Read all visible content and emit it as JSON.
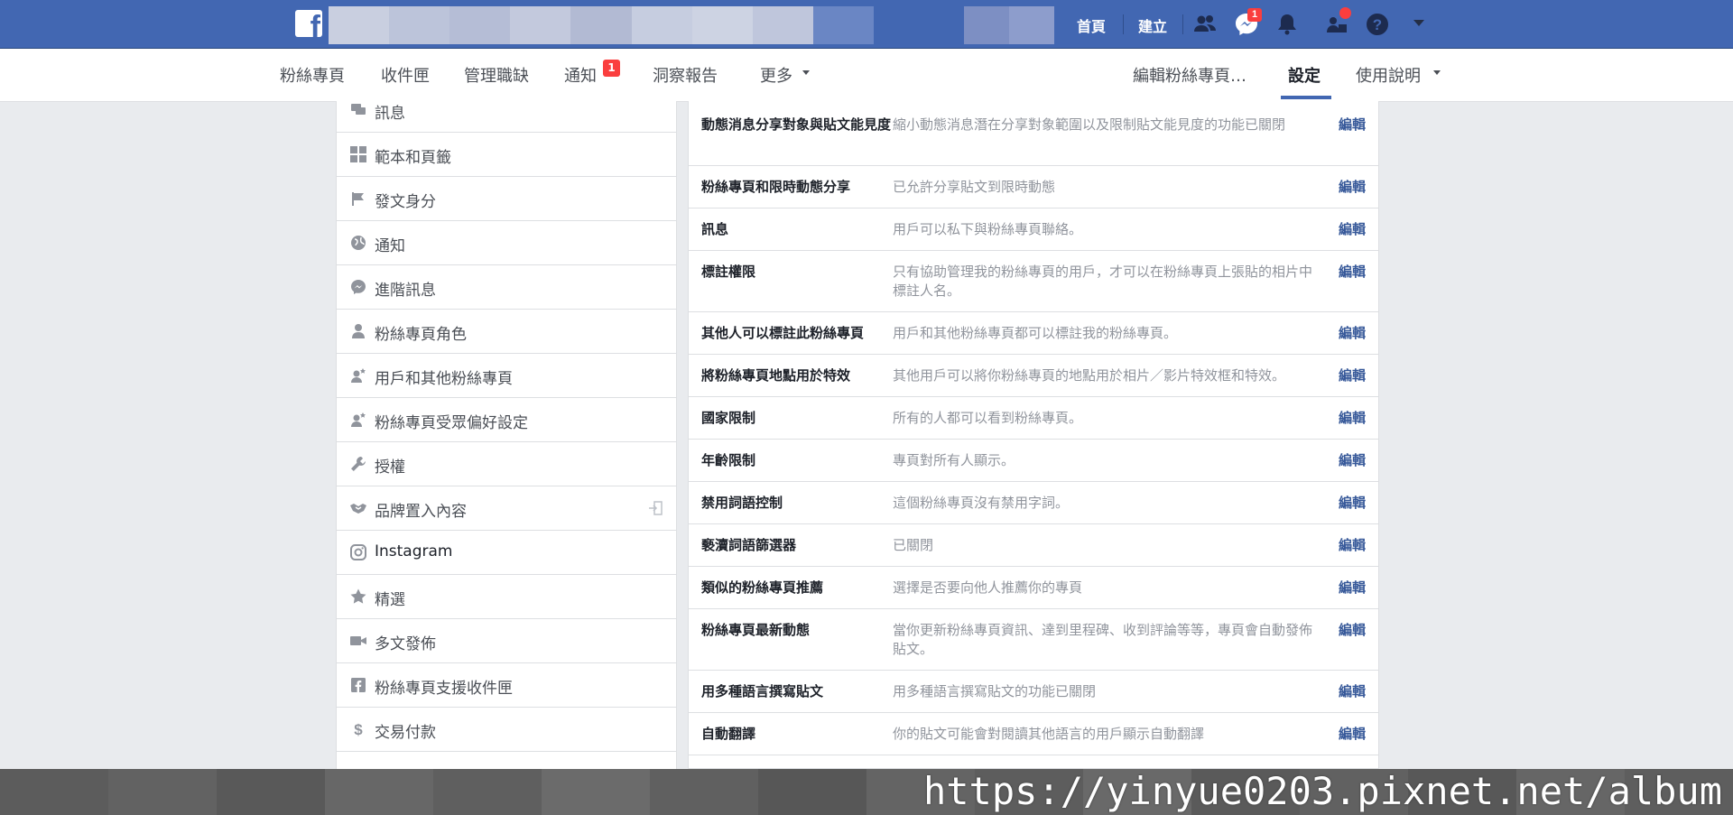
{
  "topbar": {
    "logo_letter": "f",
    "links": {
      "home": "首頁",
      "create": "建立"
    },
    "messenger_badge": "1",
    "colors": {
      "bar": "#4267b2",
      "badge": "#fa3e3e"
    }
  },
  "subnav": {
    "left_items": [
      "粉絲專頁",
      "收件匣",
      "管理職缺",
      "通知",
      "洞察報告",
      "更多"
    ],
    "notification_badge": "1",
    "right_items": [
      "編輯粉絲專頁…",
      "設定",
      "使用說明"
    ],
    "active": "設定"
  },
  "sidebar": {
    "items": [
      {
        "label": "訊息",
        "icon": "chat-bubbles-icon"
      },
      {
        "label": "範本和頁籤",
        "icon": "grid-icon"
      },
      {
        "label": "發文身分",
        "icon": "flag-icon"
      },
      {
        "label": "通知",
        "icon": "globe-icon"
      },
      {
        "label": "進階訊息",
        "icon": "messenger-icon"
      },
      {
        "label": "粉絲專頁角色",
        "icon": "person-icon"
      },
      {
        "label": "用戶和其他粉絲專頁",
        "icon": "person-star-icon"
      },
      {
        "label": "粉絲專頁受眾偏好設定",
        "icon": "person-star-icon"
      },
      {
        "label": "授權",
        "icon": "wrench-icon"
      },
      {
        "label": "品牌置入內容",
        "icon": "handshake-icon"
      },
      {
        "label": "Instagram",
        "icon": "instagram-icon"
      },
      {
        "label": "精選",
        "icon": "star-icon"
      },
      {
        "label": "多文發佈",
        "icon": "video-camera-icon"
      },
      {
        "label": "粉絲專頁支援收件匣",
        "icon": "facebook-square-icon"
      },
      {
        "label": "交易付款",
        "icon": "dollar-icon"
      }
    ]
  },
  "settings": {
    "edit_label": "編輯",
    "rows": [
      {
        "label": "動態消息分享對象與貼文能見度",
        "desc": "縮小動態消息潛在分享對象範圍以及限制貼文能見度的功能已關閉"
      },
      {
        "label": "粉絲專頁和限時動態分享",
        "desc": "已允許分享貼文到限時動態"
      },
      {
        "label": "訊息",
        "desc": "用戶可以私下與粉絲專頁聯絡。"
      },
      {
        "label": "標註權限",
        "desc": "只有協助管理我的粉絲專頁的用戶，才可以在粉絲專頁上張貼的相片中標註人名。"
      },
      {
        "label": "其他人可以標註此粉絲專頁",
        "desc": "用戶和其他粉絲專頁都可以標註我的粉絲專頁。"
      },
      {
        "label": "將粉絲專頁地點用於特效",
        "desc": "其他用戶可以將你粉絲專頁的地點用於相片／影片特效框和特效。"
      },
      {
        "label": "國家限制",
        "desc": "所有的人都可以看到粉絲專頁。"
      },
      {
        "label": "年齡限制",
        "desc": "專頁對所有人顯示。"
      },
      {
        "label": "禁用詞語控制",
        "desc": "這個粉絲專頁沒有禁用字詞。"
      },
      {
        "label": "褻瀆詞語篩選器",
        "desc": "已關閉"
      },
      {
        "label": "類似的粉絲專頁推薦",
        "desc": "選擇是否要向他人推薦你的專頁"
      },
      {
        "label": "粉絲專頁最新動態",
        "desc": "當你更新粉絲專頁資訊、達到里程碑、收到評論等等，專頁會自動發佈貼文。"
      },
      {
        "label": "用多種語言撰寫貼文",
        "desc": "用多種語言撰寫貼文的功能已關閉"
      },
      {
        "label": "自動翻譯",
        "desc": "你的貼文可能會對閱讀其他語言的用戶顯示自動翻譯"
      }
    ]
  },
  "watermark": "https://yinyue0203.pixnet.net/album"
}
